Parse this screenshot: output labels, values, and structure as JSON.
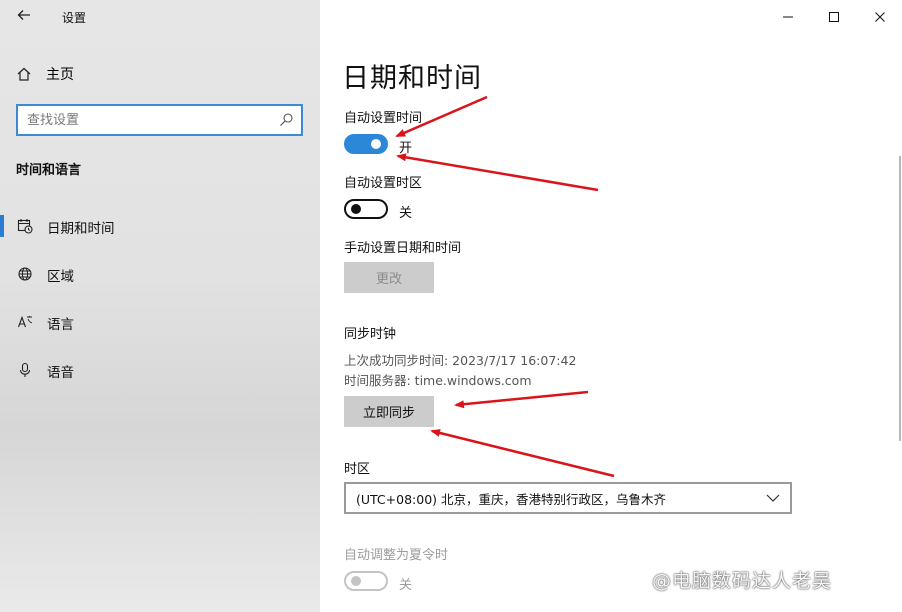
{
  "window": {
    "title": "设置",
    "back_icon": "back-arrow-icon",
    "controls": [
      "minimize-icon",
      "maximize-icon",
      "close-icon"
    ]
  },
  "sidebar": {
    "home_label": "主页",
    "search_placeholder": "查找设置",
    "section_title": "时间和语言",
    "items": [
      {
        "label": "日期和时间",
        "icon": "calendar-clock-icon",
        "active": true
      },
      {
        "label": "区域",
        "icon": "globe-icon",
        "active": false
      },
      {
        "label": "语言",
        "icon": "language-icon",
        "active": false
      },
      {
        "label": "语音",
        "icon": "microphone-icon",
        "active": false
      }
    ]
  },
  "main": {
    "title": "日期和时间",
    "auto_time": {
      "label": "自动设置时间",
      "state": "开",
      "on": true
    },
    "auto_timezone": {
      "label": "自动设置时区",
      "state": "关",
      "on": false
    },
    "manual": {
      "label": "手动设置日期和时间",
      "button": "更改"
    },
    "sync": {
      "label": "同步时钟",
      "last_sync": "上次成功同步时间: 2023/7/17 16:07:42",
      "server": "时间服务器: time.windows.com",
      "button": "立即同步"
    },
    "timezone": {
      "label": "时区",
      "value": "(UTC+08:00) 北京，重庆，香港特别行政区，乌鲁木齐"
    },
    "dst": {
      "label": "自动调整为夏令时",
      "state": "关",
      "on": false
    }
  },
  "watermark": "@电脑数码达人老吴",
  "colors": {
    "accent": "#2b88d8",
    "annotation_arrow": "#d9141b"
  }
}
